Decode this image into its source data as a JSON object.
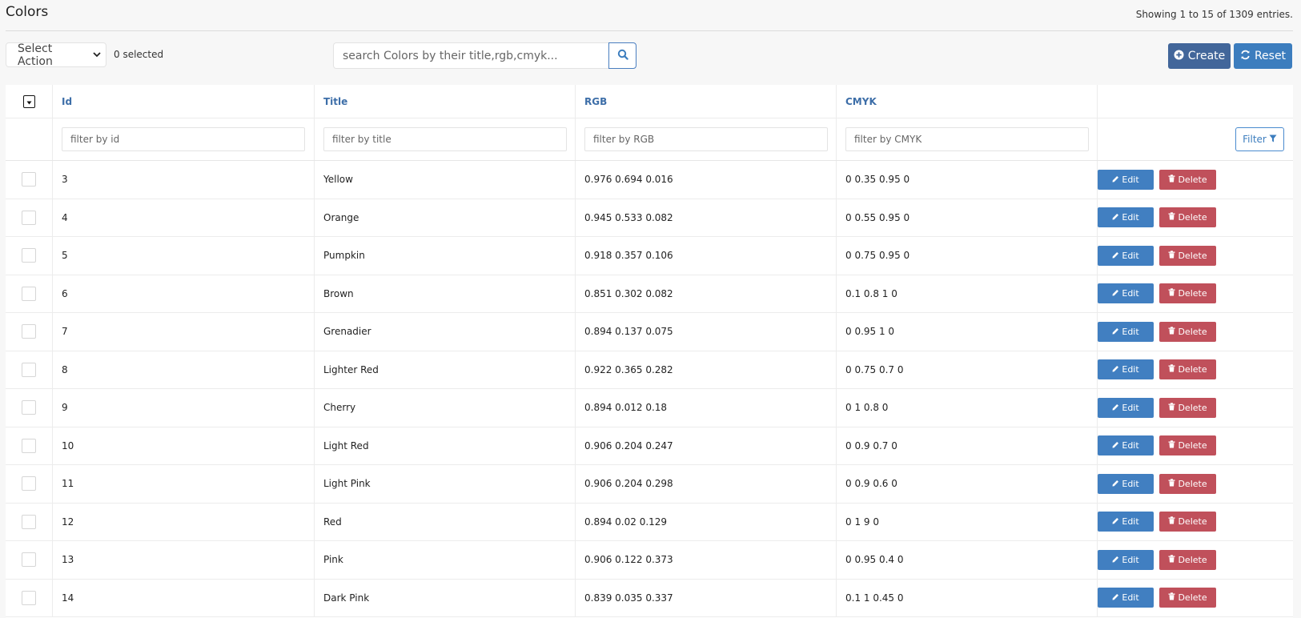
{
  "header": {
    "title": "Colors",
    "showing": "Showing 1 to 15 of 1309 entries."
  },
  "toolbar": {
    "select_action": "Select Action",
    "selected_count": "0 selected",
    "search_placeholder": "search Colors by their title,rgb,cmyk...",
    "create_label": "Create",
    "reset_label": "Reset"
  },
  "table": {
    "columns": [
      "Id",
      "Title",
      "RGB",
      "CMYK"
    ],
    "filters": [
      "filter by id",
      "filter by title",
      "filter by RGB",
      "filter by CMYK"
    ],
    "filter_button": "Filter",
    "edit_label": "Edit",
    "delete_label": "Delete",
    "rows": [
      {
        "id": "3",
        "title": "Yellow",
        "rgb": "0.976 0.694 0.016",
        "cmyk": "0 0.35 0.95 0"
      },
      {
        "id": "4",
        "title": "Orange",
        "rgb": "0.945 0.533 0.082",
        "cmyk": "0 0.55 0.95 0"
      },
      {
        "id": "5",
        "title": "Pumpkin",
        "rgb": "0.918 0.357 0.106",
        "cmyk": "0 0.75 0.95 0"
      },
      {
        "id": "6",
        "title": "Brown",
        "rgb": "0.851 0.302 0.082",
        "cmyk": "0.1 0.8 1 0"
      },
      {
        "id": "7",
        "title": "Grenadier",
        "rgb": "0.894 0.137 0.075",
        "cmyk": "0 0.95 1 0"
      },
      {
        "id": "8",
        "title": "Lighter Red",
        "rgb": "0.922 0.365 0.282",
        "cmyk": "0 0.75 0.7 0"
      },
      {
        "id": "9",
        "title": "Cherry",
        "rgb": "0.894 0.012 0.18",
        "cmyk": "0 1 0.8 0"
      },
      {
        "id": "10",
        "title": "Light Red",
        "rgb": "0.906 0.204 0.247",
        "cmyk": "0 0.9 0.7 0"
      },
      {
        "id": "11",
        "title": "Light Pink",
        "rgb": "0.906 0.204 0.298",
        "cmyk": "0 0.9 0.6 0"
      },
      {
        "id": "12",
        "title": "Red",
        "rgb": "0.894 0.02 0.129",
        "cmyk": "0 1 9 0"
      },
      {
        "id": "13",
        "title": "Pink",
        "rgb": "0.906 0.122 0.373",
        "cmyk": "0 0.95 0.4 0"
      },
      {
        "id": "14",
        "title": "Dark Pink",
        "rgb": "0.839 0.035 0.337",
        "cmyk": "0.1 1 0.45 0"
      }
    ]
  },
  "colors": {
    "primary": "#3c7dbe",
    "create": "#42669a",
    "danger": "#c0505b",
    "header_text": "#3d6ea8"
  },
  "icons": {
    "search": "search-icon",
    "create": "plus-circle-icon",
    "reset": "refresh-icon",
    "filter": "filter-icon",
    "edit": "pencil-icon",
    "delete": "trash-icon",
    "select_chevron": "chevron-down-icon",
    "bulk_toggle": "caret-down-icon"
  }
}
